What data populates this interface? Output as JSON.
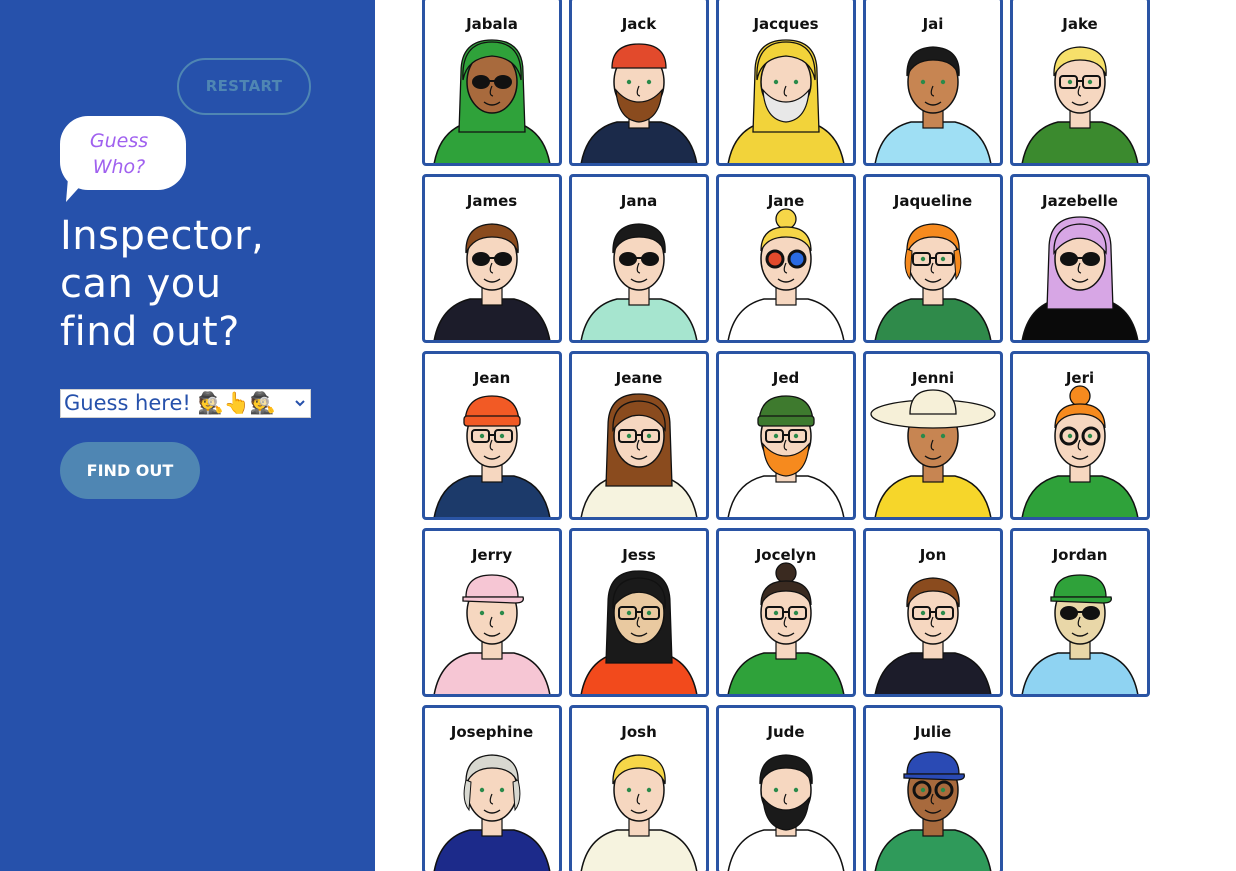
{
  "game": {
    "restart_label": "RESTART",
    "bubble_line1": "Guess",
    "bubble_line2": "Who?",
    "headline_line1": "Inspector,",
    "headline_line2": "can you",
    "headline_line3": "find out?",
    "select_value": "Guess here! 🕵👆🕵",
    "find_out_label": "FIND OUT",
    "sidebar_color": "#2651ab",
    "button_color": "#4f86b3"
  },
  "characters": [
    {
      "name": "Jabala",
      "skin": "#a86a3d",
      "hair": "#2fa23a",
      "shirt": "#2fa23a",
      "style": "hijab",
      "glasses": "sun"
    },
    {
      "name": "Jack",
      "skin": "#f6d7c0",
      "hair": "#e24a2c",
      "shirt": "#1b2a4a",
      "style": "bandana",
      "beard": "#8a4b1e"
    },
    {
      "name": "Jacques",
      "skin": "#f6d7c0",
      "hair": "#f2d33a",
      "shirt": "#f2d33a",
      "style": "hood",
      "beard": "#e8e8e8"
    },
    {
      "name": "Jai",
      "skin": "#c78552",
      "hair": "#1a1a1a",
      "shirt": "#9fdff4",
      "style": "short"
    },
    {
      "name": "Jake",
      "skin": "#f6d7c0",
      "hair": "#f6e06a",
      "shirt": "#3b8a2e",
      "style": "short",
      "glasses": "clear"
    },
    {
      "name": "James",
      "skin": "#f6d7c0",
      "hair": "#8a4b1e",
      "shirt": "#1c1c2a",
      "style": "short",
      "glasses": "sun"
    },
    {
      "name": "Jana",
      "skin": "#f6d7c0",
      "hair": "#1a1a1a",
      "shirt": "#a6e5cf",
      "style": "short",
      "glasses": "sun"
    },
    {
      "name": "Jane",
      "skin": "#f6d7c0",
      "hair": "#f6d648",
      "shirt": "#ffffff",
      "style": "bun",
      "glasses": "3d"
    },
    {
      "name": "Jaqueline",
      "skin": "#f6d7c0",
      "hair": "#f68a1e",
      "shirt": "#2f8a4a",
      "style": "bob",
      "glasses": "clear"
    },
    {
      "name": "Jazebelle",
      "skin": "#f6d7c0",
      "hair": "#d7a6e5",
      "shirt": "#0a0a0a",
      "style": "long",
      "glasses": "sun"
    },
    {
      "name": "Jean",
      "skin": "#f6d7c0",
      "hair": "#f25a25",
      "shirt": "#1c3a6a",
      "style": "beanie",
      "glasses": "clear"
    },
    {
      "name": "Jeane",
      "skin": "#f6d7c0",
      "hair": "#8a4b1e",
      "shirt": "#f6f3df",
      "style": "long",
      "glasses": "clear"
    },
    {
      "name": "Jed",
      "skin": "#f6d7c0",
      "hair": "#3e7a2e",
      "shirt": "#ffffff",
      "style": "beanie",
      "glasses": "clear",
      "beard": "#f68a1e"
    },
    {
      "name": "Jenni",
      "skin": "#c78552",
      "hair": "#f6f0d8",
      "shirt": "#f6d62a",
      "style": "hat"
    },
    {
      "name": "Jeri",
      "skin": "#f6d7c0",
      "hair": "#f68a1e",
      "shirt": "#2fa23a",
      "style": "bun",
      "glasses": "round"
    },
    {
      "name": "Jerry",
      "skin": "#f6d7c0",
      "hair": "#f6c6d4",
      "shirt": "#f6c6d4",
      "style": "cap"
    },
    {
      "name": "Jess",
      "skin": "#e9c9a0",
      "hair": "#1a1a1a",
      "shirt": "#f24a1c",
      "style": "long",
      "glasses": "clear"
    },
    {
      "name": "Jocelyn",
      "skin": "#f6d7c0",
      "hair": "#3a2a20",
      "shirt": "#2fa23a",
      "style": "bun",
      "glasses": "clear"
    },
    {
      "name": "Jon",
      "skin": "#f6d7c0",
      "hair": "#8a4b1e",
      "shirt": "#1c1c2a",
      "style": "short",
      "glasses": "clear"
    },
    {
      "name": "Jordan",
      "skin": "#e9d7a8",
      "hair": "#2fa23a",
      "shirt": "#8fd3f2",
      "style": "cap",
      "glasses": "sun"
    },
    {
      "name": "Josephine",
      "skin": "#f6d7c0",
      "hair": "#d8d8d0",
      "shirt": "#1c2a8a",
      "style": "bob"
    },
    {
      "name": "Josh",
      "skin": "#f6d7c0",
      "hair": "#f6d648",
      "shirt": "#f6f3df",
      "style": "short"
    },
    {
      "name": "Jude",
      "skin": "#f6d7c0",
      "hair": "#1a1a1a",
      "shirt": "#ffffff",
      "style": "short",
      "beard": "#1a1a1a"
    },
    {
      "name": "Julie",
      "skin": "#a86a3d",
      "hair": "#2a4ab4",
      "shirt": "#2f9a5a",
      "style": "cap",
      "glasses": "round"
    }
  ]
}
